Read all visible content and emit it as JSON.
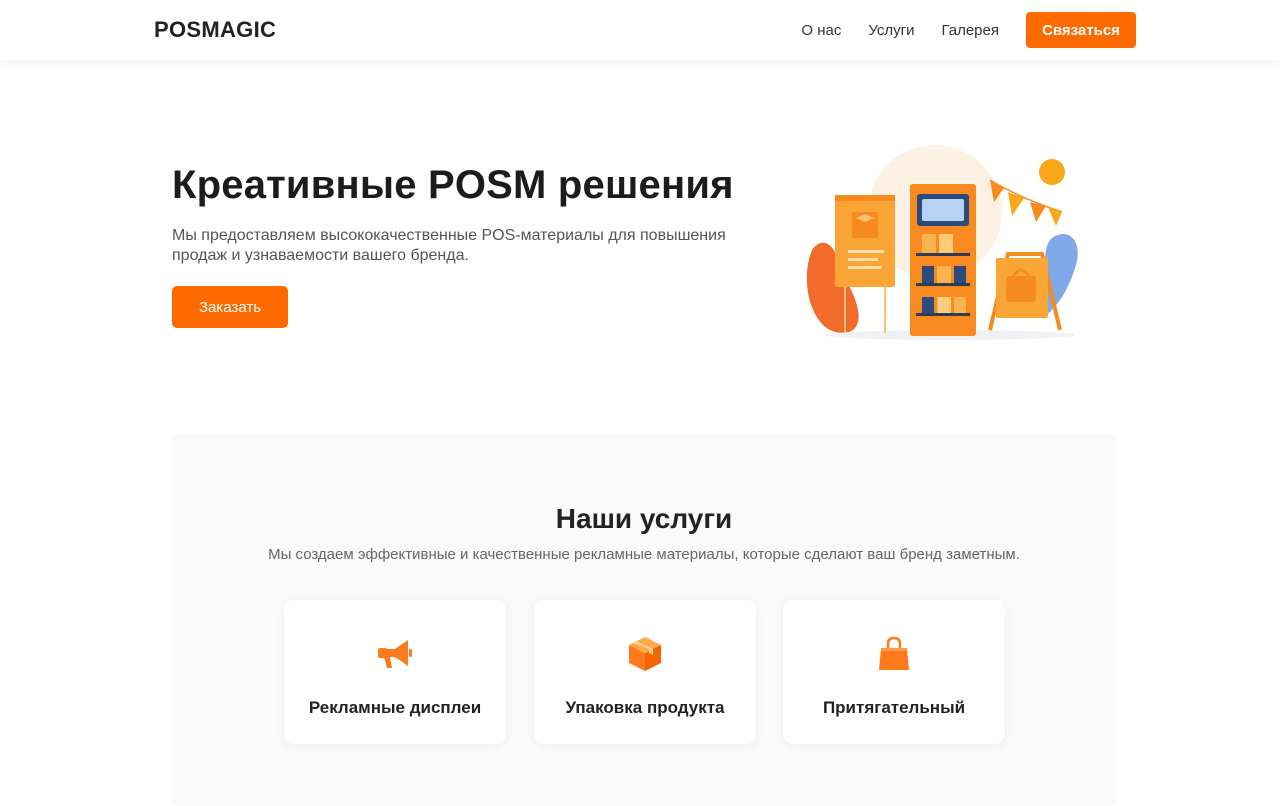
{
  "header": {
    "logo": "POSMAGIC",
    "nav": [
      "О нас",
      "Услуги",
      "Галерея"
    ],
    "cta": "Связаться"
  },
  "hero": {
    "title": "Креативные POSM решения",
    "subtitle": "Мы предоставляем высококачественные POS-материалы для повышения продаж и узнаваемости вашего бренда.",
    "button": "Заказать",
    "illustration": "posm-stand-illustration"
  },
  "services": {
    "title": "Наши услуги",
    "subtitle": "Мы создаем эффективные и качественные рекламные материалы, которые сделают ваш бренд заметным.",
    "cards": [
      {
        "label": "Рекламные дисплеи",
        "icon": "megaphone-icon"
      },
      {
        "label": "Упаковка продукта",
        "icon": "box-icon"
      },
      {
        "label": "Притягательный",
        "icon": "shopping-bag-icon"
      }
    ]
  },
  "colors": {
    "accent": "#ff6a00",
    "text": "#1f1f1f",
    "muted": "#555555",
    "section_bg": "#fafafa"
  }
}
